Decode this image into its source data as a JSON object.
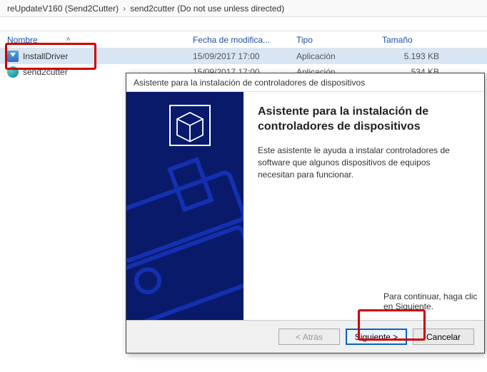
{
  "breadcrumb": {
    "seg1": "reUpdateV160 (Send2Cutter)",
    "seg2": "send2cutter (Do not use unless directed)"
  },
  "columns": {
    "name": "Nombre",
    "date": "Fecha de modifica...",
    "type": "Tipo",
    "size": "Tamaño"
  },
  "files": [
    {
      "name": "InstallDriver",
      "date": "15/09/2017 17:00",
      "type": "Aplicación",
      "size": "5.193 KB",
      "icon": "installer",
      "selected": true
    },
    {
      "name": "send2cutter",
      "date": "15/09/2017 17:00",
      "type": "Aplicación",
      "size": "534 KB",
      "icon": "cutter",
      "selected": false
    }
  ],
  "wizard": {
    "title": "Asistente para la instalación de controladores de dispositivos",
    "heading": "Asistente para la instalación de controladores de dispositivos",
    "body": "Este asistente le ayuda a instalar controladores de software que algunos dispositivos de equipos necesitan para funcionar.",
    "continue": "Para continuar, haga clic en Siguiente.",
    "buttons": {
      "back": "< Atrás",
      "next": "Siguiente >",
      "cancel": "Cancelar"
    }
  }
}
